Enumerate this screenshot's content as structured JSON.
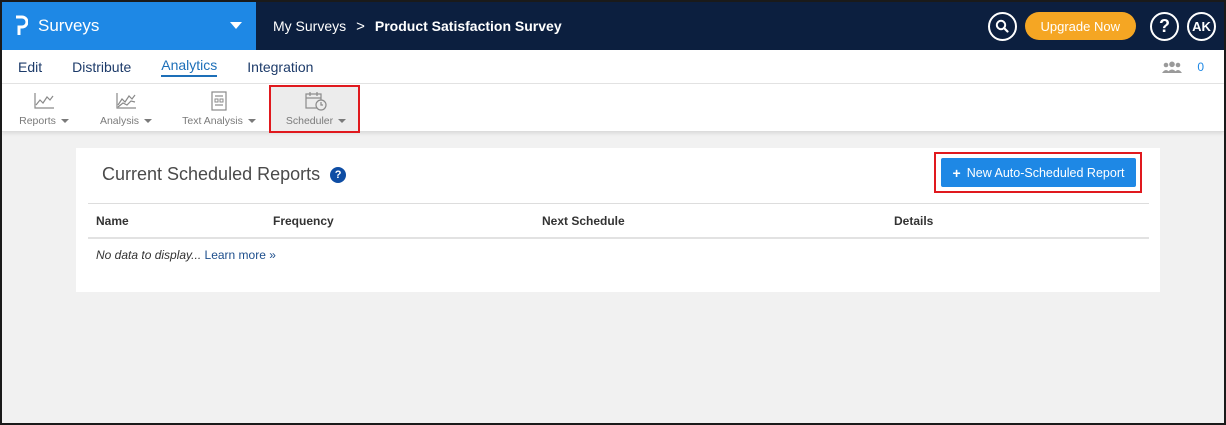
{
  "app": {
    "title": "Surveys"
  },
  "breadcrumb": {
    "parent": "My Surveys",
    "separator": ">",
    "current": "Product Satisfaction Survey"
  },
  "header": {
    "upgrade_label": "Upgrade Now",
    "help_label": "?",
    "avatar_initials": "AK"
  },
  "tabs": [
    {
      "label": "Edit"
    },
    {
      "label": "Distribute"
    },
    {
      "label": "Analytics",
      "active": true
    },
    {
      "label": "Integration"
    }
  ],
  "collaborators": {
    "count": "0"
  },
  "toolbar": {
    "items": [
      {
        "label": "Reports",
        "icon": "line-chart-icon"
      },
      {
        "label": "Analysis",
        "icon": "analysis-chart-icon"
      },
      {
        "label": "Text Analysis",
        "icon": "text-analysis-icon"
      },
      {
        "label": "Scheduler",
        "icon": "calendar-clock-icon"
      }
    ]
  },
  "panel": {
    "title": "Current Scheduled Reports",
    "help_icon": "?",
    "new_button_label": "New Auto-Scheduled Report",
    "columns": [
      "Name",
      "Frequency",
      "Next Schedule",
      "Details"
    ],
    "empty_text": "No data to display...",
    "learn_more": "Learn more »"
  },
  "colors": {
    "brand": "#1e88e5",
    "topbar": "#0c1f3f",
    "upgrade": "#f5a623",
    "highlight": "#e0191e"
  }
}
